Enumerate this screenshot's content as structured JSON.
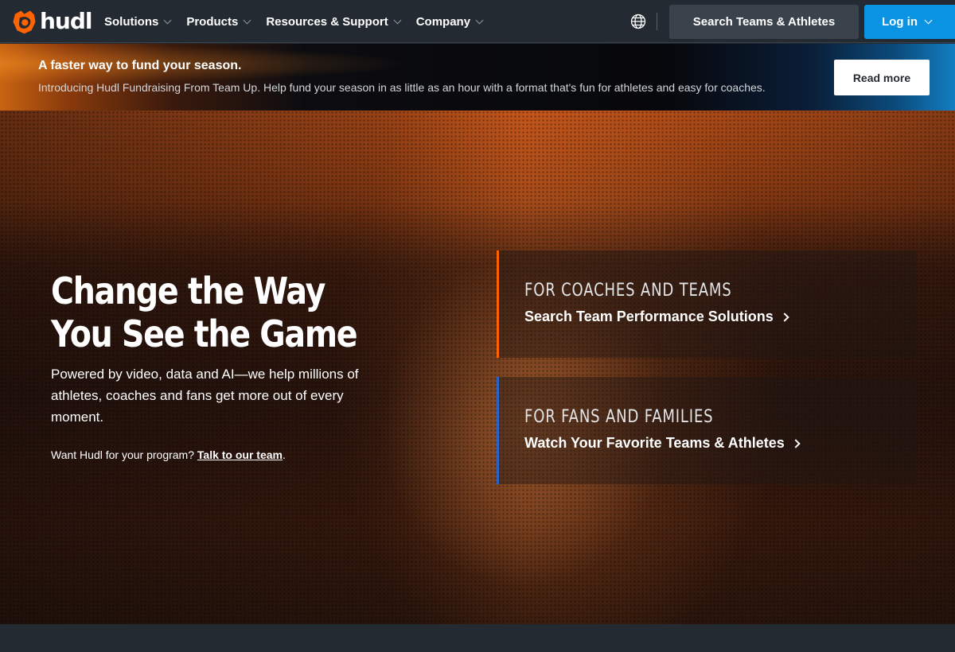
{
  "brand": {
    "name": "hudl",
    "logo_icon": "hudl-logo-icon",
    "accent": "#ff6300"
  },
  "nav": {
    "items": [
      {
        "label": "Solutions"
      },
      {
        "label": "Products"
      },
      {
        "label": "Resources & Support"
      },
      {
        "label": "Company"
      }
    ],
    "globe_icon": "globe-icon",
    "search_label": "Search Teams & Athletes",
    "login_label": "Log in",
    "login_color": "#0a93e2"
  },
  "banner": {
    "title": "A faster way to fund your season.",
    "text": "Introducing Hudl Fundraising From Team Up. Help fund your season in as little as an hour with a format that's fun for athletes and easy for coaches.",
    "button": "Read more"
  },
  "hero": {
    "title_line1": "Change the Way",
    "title_line2": "You See the Game",
    "subtitle": "Powered by video, data and AI—we help millions of athletes, coaches and fans get more out of every moment.",
    "cta_prefix": "Want Hudl for your program? ",
    "cta_link": "Talk to our team",
    "cta_suffix": ".",
    "cards": [
      {
        "eyebrow": "FOR COACHES AND TEAMS",
        "link": "Search Team Performance Solutions",
        "accent": "#ff6300"
      },
      {
        "eyebrow": "FOR FANS AND FAMILIES",
        "link": "Watch Your Favorite Teams & Athletes",
        "accent": "#2b63c9"
      }
    ]
  }
}
